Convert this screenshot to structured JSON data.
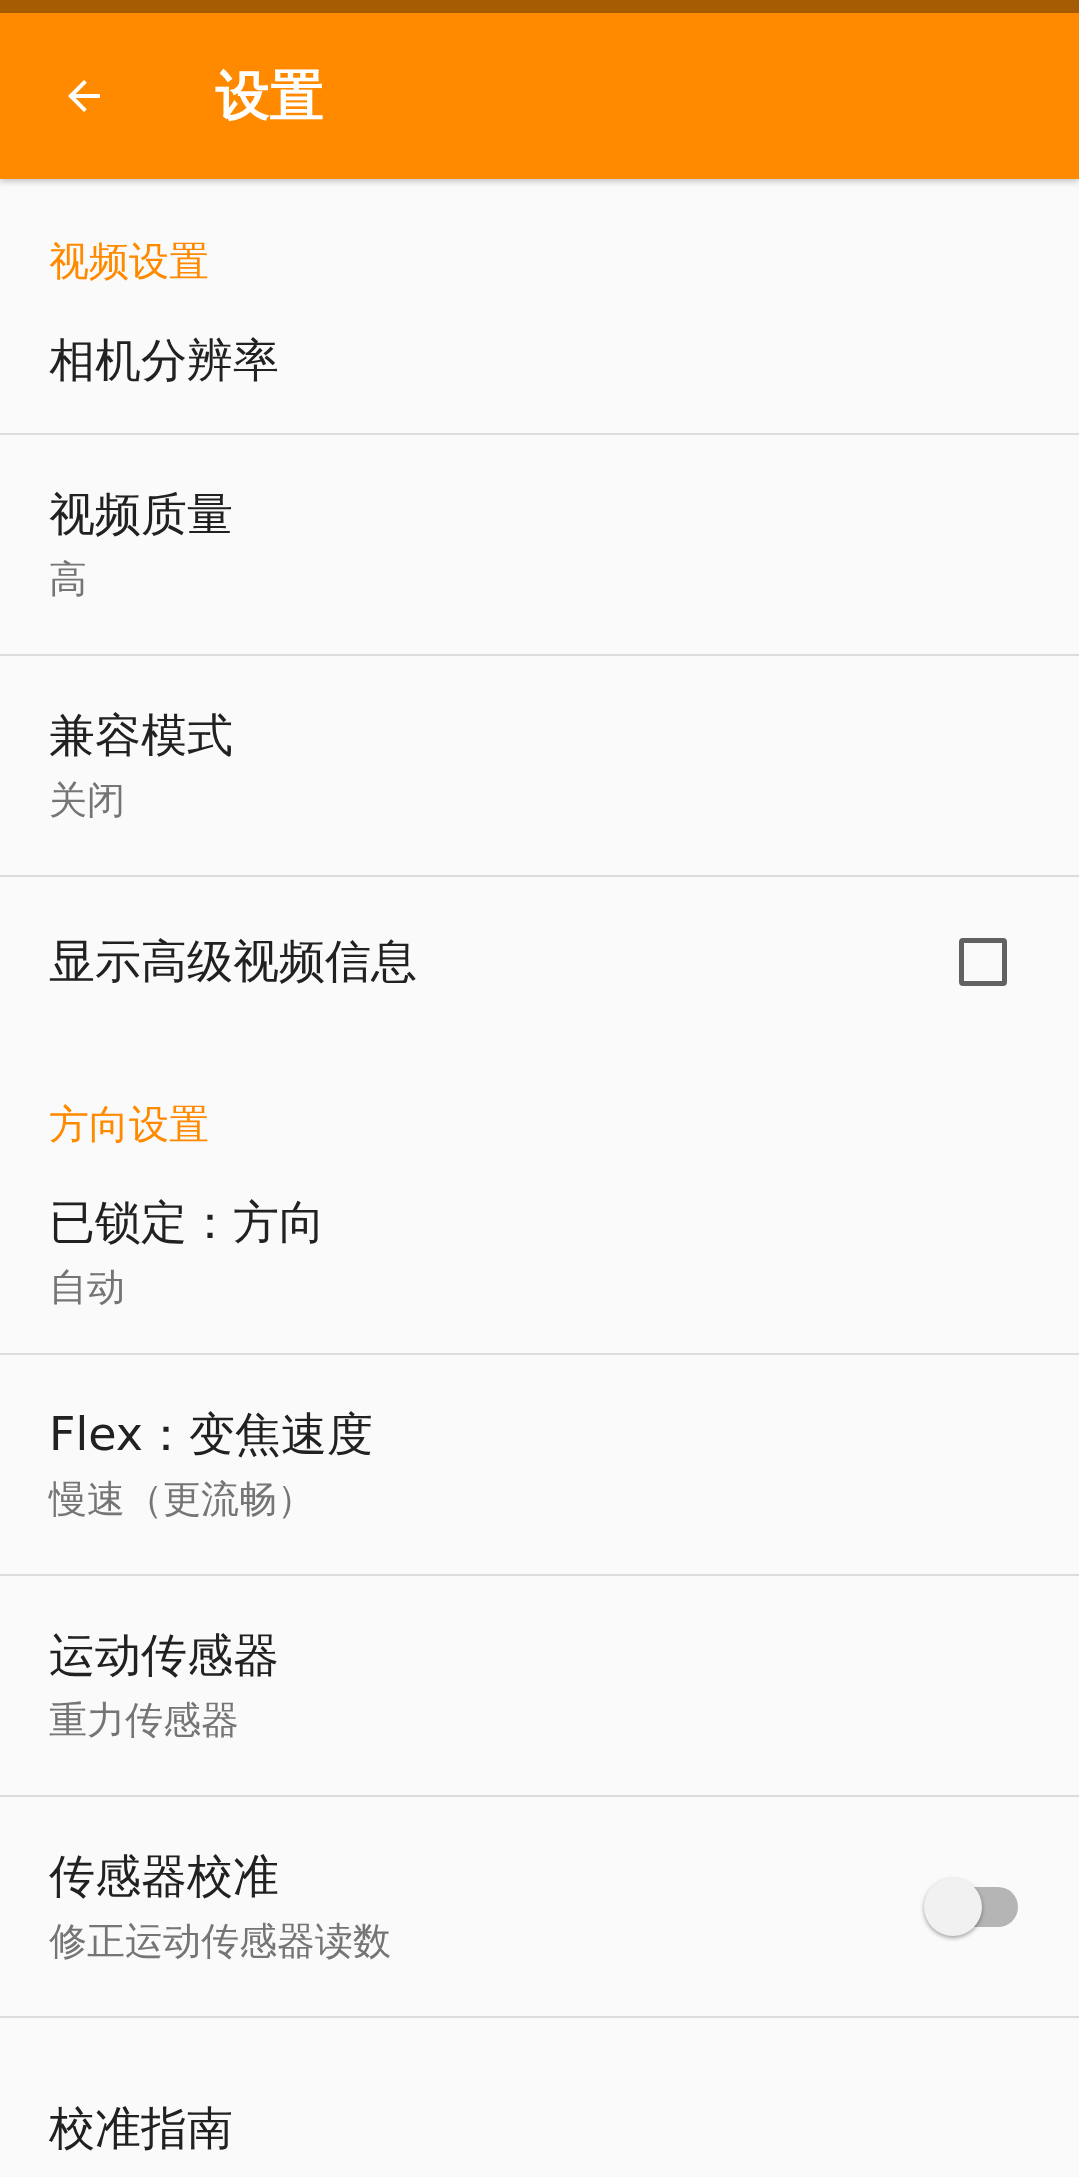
{
  "toolbar": {
    "title": "设置"
  },
  "sections": [
    {
      "title": "视频设置",
      "items": [
        {
          "kind": "text",
          "title": "相机分辨率"
        },
        {
          "kind": "text",
          "title": "视频质量",
          "summary": "高"
        },
        {
          "kind": "text",
          "title": "兼容模式",
          "summary": "关闭"
        },
        {
          "kind": "checkbox",
          "title": "显示高级视频信息",
          "checked": false
        }
      ]
    },
    {
      "title": "方向设置",
      "items": [
        {
          "kind": "text",
          "title": "已锁定：方向",
          "summary": "自动"
        },
        {
          "kind": "text",
          "title": "Flex：变焦速度",
          "summary": "慢速（更流畅）"
        },
        {
          "kind": "text",
          "title": "运动传感器",
          "summary": "重力传感器"
        },
        {
          "kind": "switch",
          "title": "传感器校准",
          "summary": "修正运动传感器读数",
          "on": false
        },
        {
          "kind": "text",
          "title": "校准指南"
        }
      ]
    }
  ]
}
